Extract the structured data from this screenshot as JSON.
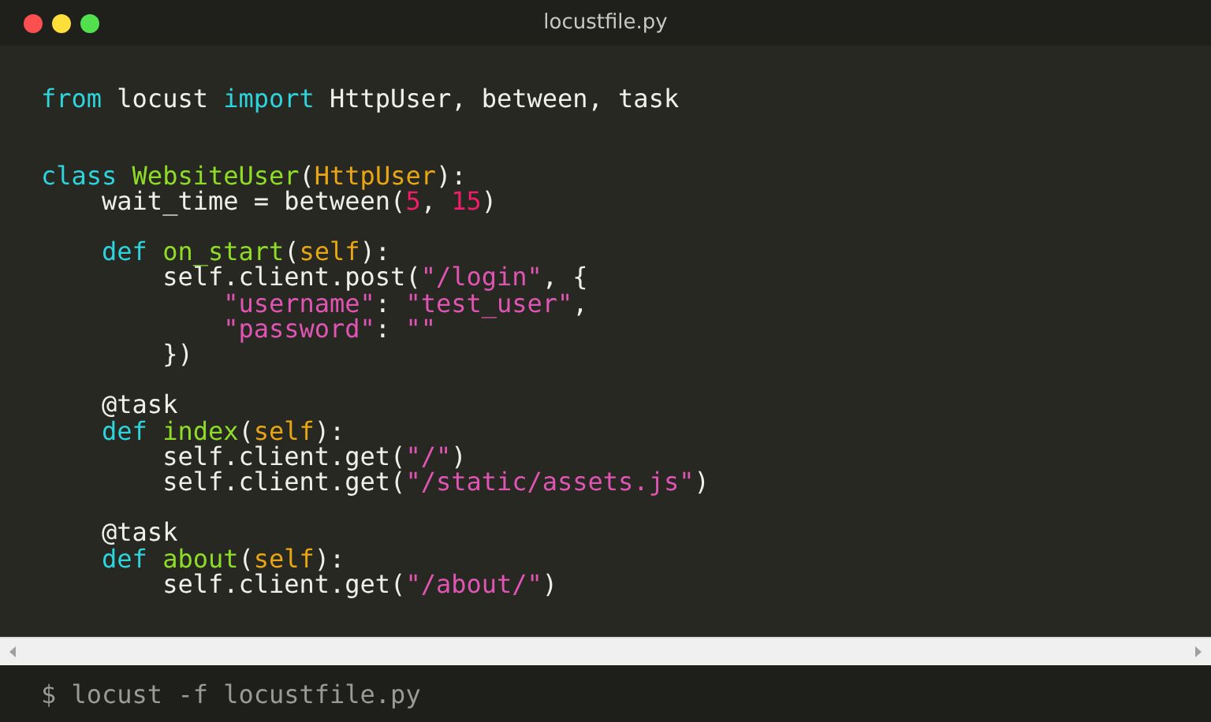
{
  "window": {
    "title": "locustfile.py"
  },
  "code_blocks": [
    [
      [
        {
          "kind": "keyword",
          "text": "from"
        },
        {
          "kind": "plain",
          "text": " locust "
        },
        {
          "kind": "keyword",
          "text": "import"
        },
        {
          "kind": "plain",
          "text": " HttpUser, between, task"
        }
      ]
    ],
    [
      [
        {
          "kind": "keyword",
          "text": "class "
        },
        {
          "kind": "name",
          "text": "WebsiteUser"
        },
        {
          "kind": "plain",
          "text": "("
        },
        {
          "kind": "argument",
          "text": "HttpUser"
        },
        {
          "kind": "plain",
          "text": "):"
        }
      ],
      [
        {
          "kind": "plain",
          "text": "    wait_time = between("
        },
        {
          "kind": "number",
          "text": "5"
        },
        {
          "kind": "plain",
          "text": ", "
        },
        {
          "kind": "number",
          "text": "15"
        },
        {
          "kind": "plain",
          "text": ")"
        }
      ]
    ],
    [
      [
        {
          "kind": "keyword",
          "text": "    def "
        },
        {
          "kind": "name",
          "text": "on_start"
        },
        {
          "kind": "plain",
          "text": "("
        },
        {
          "kind": "argument",
          "text": "self"
        },
        {
          "kind": "plain",
          "text": "):"
        }
      ],
      [
        {
          "kind": "plain",
          "text": "        self.client.post("
        },
        {
          "kind": "string",
          "text": "\"/login\""
        },
        {
          "kind": "plain",
          "text": ", {"
        }
      ],
      [
        {
          "kind": "string",
          "text": "            \"username\""
        },
        {
          "kind": "plain",
          "text": ": "
        },
        {
          "kind": "string",
          "text": "\"test_user\""
        },
        {
          "kind": "plain",
          "text": ","
        }
      ],
      [
        {
          "kind": "string",
          "text": "            \"password\""
        },
        {
          "kind": "plain",
          "text": ": "
        },
        {
          "kind": "string",
          "text": "\"\""
        }
      ],
      [
        {
          "kind": "plain",
          "text": "        })"
        }
      ]
    ],
    [
      [
        {
          "kind": "plain",
          "text": "    @task"
        }
      ],
      [
        {
          "kind": "keyword",
          "text": "    def "
        },
        {
          "kind": "name",
          "text": "index"
        },
        {
          "kind": "plain",
          "text": "("
        },
        {
          "kind": "argument",
          "text": "self"
        },
        {
          "kind": "plain",
          "text": "):"
        }
      ],
      [
        {
          "kind": "plain",
          "text": "        self.client.get("
        },
        {
          "kind": "string",
          "text": "\"/\""
        },
        {
          "kind": "plain",
          "text": ")"
        }
      ],
      [
        {
          "kind": "plain",
          "text": "        self.client.get("
        },
        {
          "kind": "string",
          "text": "\"/static/assets.js\""
        },
        {
          "kind": "plain",
          "text": ")"
        }
      ]
    ],
    [
      [
        {
          "kind": "plain",
          "text": "    @task"
        }
      ],
      [
        {
          "kind": "keyword",
          "text": "    def "
        },
        {
          "kind": "name",
          "text": "about"
        },
        {
          "kind": "plain",
          "text": "("
        },
        {
          "kind": "argument",
          "text": "self"
        },
        {
          "kind": "plain",
          "text": "):"
        }
      ],
      [
        {
          "kind": "plain",
          "text": "        self.client.get("
        },
        {
          "kind": "string",
          "text": "\"/about/\""
        },
        {
          "kind": "plain",
          "text": ")"
        }
      ]
    ]
  ],
  "terminal": {
    "command": "$ locust -f locustfile.py"
  }
}
